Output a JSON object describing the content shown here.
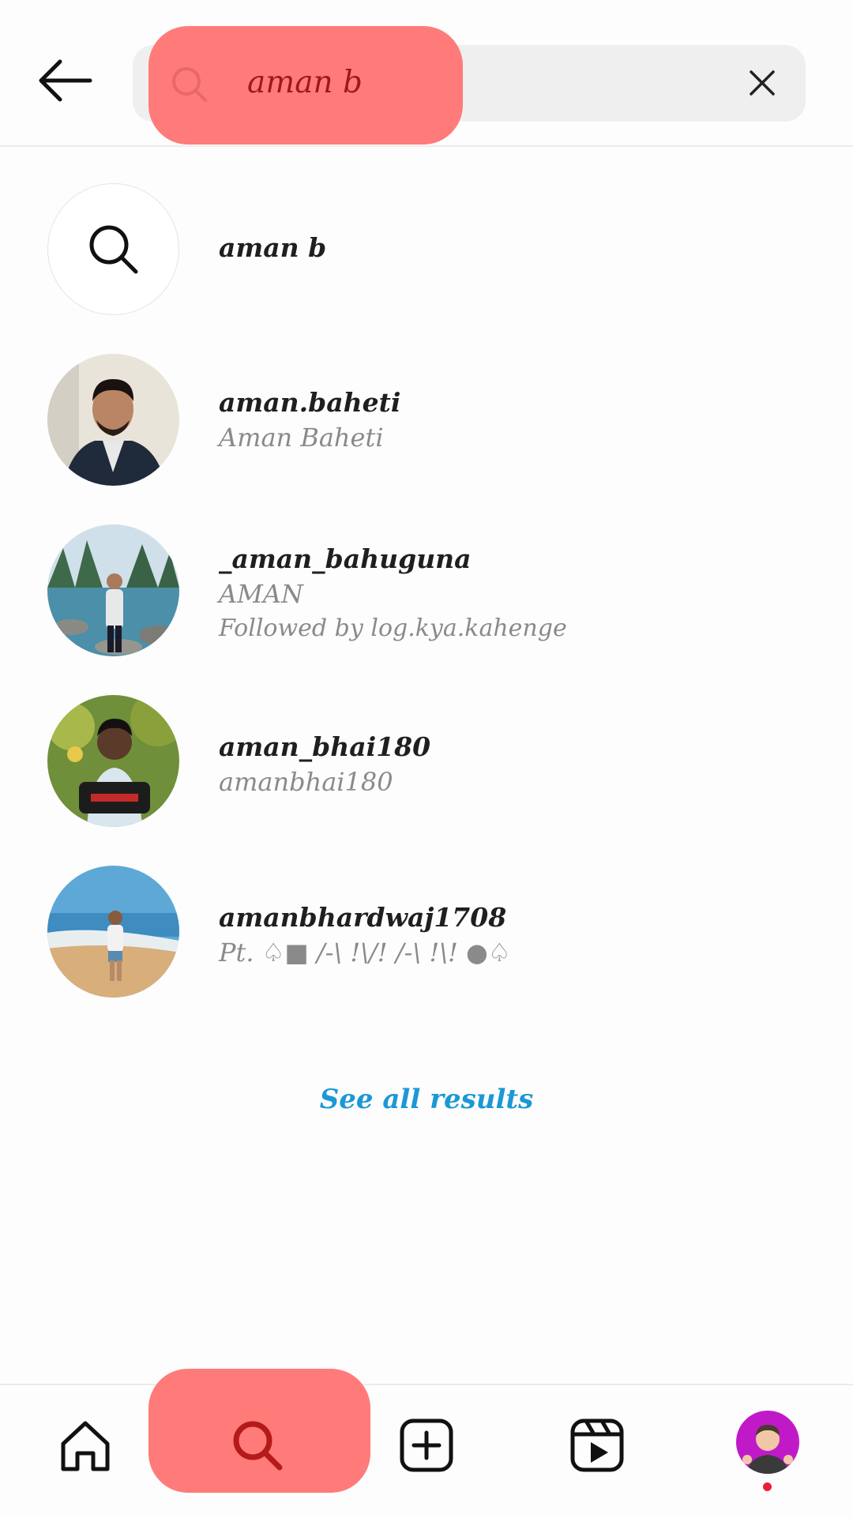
{
  "search": {
    "query": "aman b"
  },
  "results": [
    {
      "username": "aman b",
      "type": "keyword"
    },
    {
      "username": "aman.baheti",
      "full_name": "Aman Baheti"
    },
    {
      "username": "_aman_bahuguna",
      "full_name": "AMAN",
      "followed_by": "Followed by log.kya.kahenge"
    },
    {
      "username": "aman_bhai180",
      "full_name": "amanbhai180"
    },
    {
      "username": "amanbhardwaj1708",
      "full_name": "Pt. ♤■ /-\\ !\\/! /-\\ !\\! ●♤"
    }
  ],
  "see_all_label": "See all results",
  "nav": {
    "items": [
      "home-icon",
      "search-icon",
      "create-icon",
      "reels-icon",
      "profile-avatar"
    ],
    "active": "search-icon"
  },
  "colors": {
    "highlight": "#ff7b79",
    "link": "#1b98d6",
    "notification": "#ed1d3a"
  }
}
